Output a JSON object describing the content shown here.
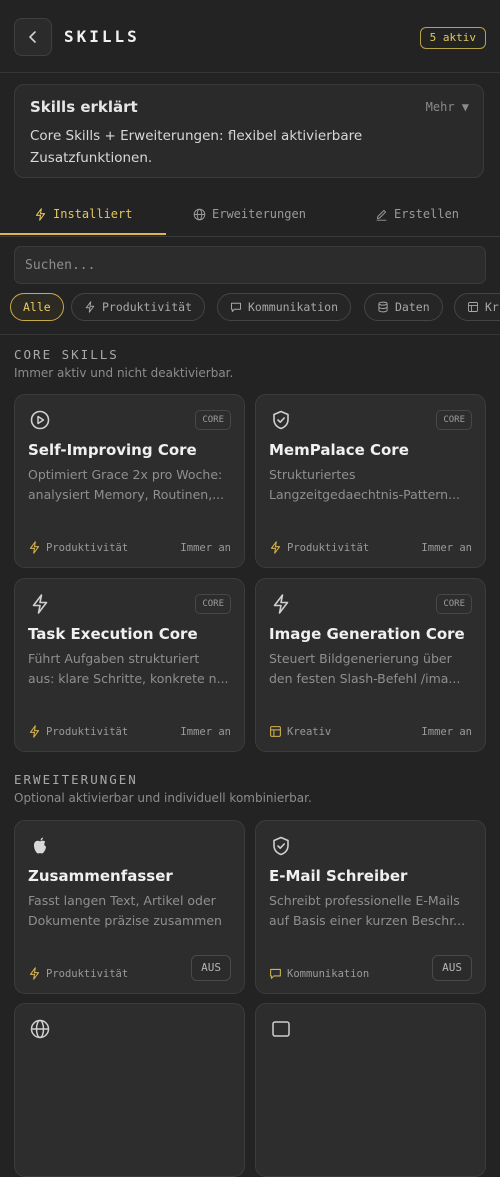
{
  "header": {
    "title": "SKILLS",
    "active_badge": "5 aktiv"
  },
  "info": {
    "title": "Skills erklärt",
    "more": "Mehr ▼",
    "text": "Core Skills + Erweiterungen: flexibel aktivierbare Zusatzfunktionen."
  },
  "tabs": [
    {
      "label": "Installiert",
      "icon": "bolt-icon",
      "active": true
    },
    {
      "label": "Erweiterungen",
      "icon": "globe-icon",
      "active": false
    },
    {
      "label": "Erstellen",
      "icon": "pen-icon",
      "active": false
    }
  ],
  "search": {
    "placeholder": "Suchen..."
  },
  "filters": [
    {
      "label": "Alle",
      "active": true
    },
    {
      "label": "Produktivität",
      "icon": "bolt-icon"
    },
    {
      "label": "Kommunikation",
      "icon": "chat-icon"
    },
    {
      "label": "Daten",
      "icon": "database-icon"
    },
    {
      "label": "Kr",
      "icon": "layout-icon"
    }
  ],
  "core": {
    "title": "CORE SKILLS",
    "subtitle": "Immer aktiv und nicht deaktivierbar.",
    "cards": [
      {
        "icon": "play-circle-icon",
        "tag": "CORE",
        "name": "Self-Improving Core",
        "desc1": "Optimiert Grace 2x pro Woche:",
        "desc2": "analysiert Memory, Routinen,...",
        "category": "Produktivität",
        "category_icon": "bolt-icon",
        "status": "Immer an"
      },
      {
        "icon": "shield-check-icon",
        "tag": "CORE",
        "name": "MemPalace Core",
        "desc1": "Strukturiertes",
        "desc2": "Langzeitgedaechtnis-Pattern...",
        "category": "Produktivität",
        "category_icon": "bolt-icon",
        "status": "Immer an"
      },
      {
        "icon": "bolt-icon",
        "tag": "CORE",
        "name": "Task Execution Core",
        "desc1": "Führt Aufgaben strukturiert",
        "desc2": "aus: klare Schritte, konkrete n...",
        "category": "Produktivität",
        "category_icon": "bolt-icon",
        "status": "Immer an"
      },
      {
        "icon": "bolt-icon",
        "tag": "CORE",
        "name": "Image Generation Core",
        "desc1": "Steuert Bildgenerierung über",
        "desc2": "den festen Slash-Befehl /ima...",
        "category": "Kreativ",
        "category_icon": "layout-icon",
        "status": "Immer an"
      }
    ]
  },
  "extensions": {
    "title": "ERWEITERUNGEN",
    "subtitle": "Optional aktivierbar und individuell kombinierbar.",
    "cards": [
      {
        "icon": "apple-icon",
        "name": "Zusammenfasser",
        "desc1": "Fasst langen Text, Artikel oder",
        "desc2": "Dokumente präzise zusammen",
        "category": "Produktivität",
        "category_icon": "bolt-icon",
        "toggle": "AUS"
      },
      {
        "icon": "shield-check-icon",
        "name": "E-Mail Schreiber",
        "desc1": "Schreibt professionelle E-Mails",
        "desc2": "auf Basis einer kurzen Beschr...",
        "category": "Kommunikation",
        "category_icon": "chat-icon",
        "toggle": "AUS"
      }
    ]
  },
  "colors": {
    "accent": "#e0c25a",
    "background": "#232323",
    "card": "#2d2d2d"
  }
}
